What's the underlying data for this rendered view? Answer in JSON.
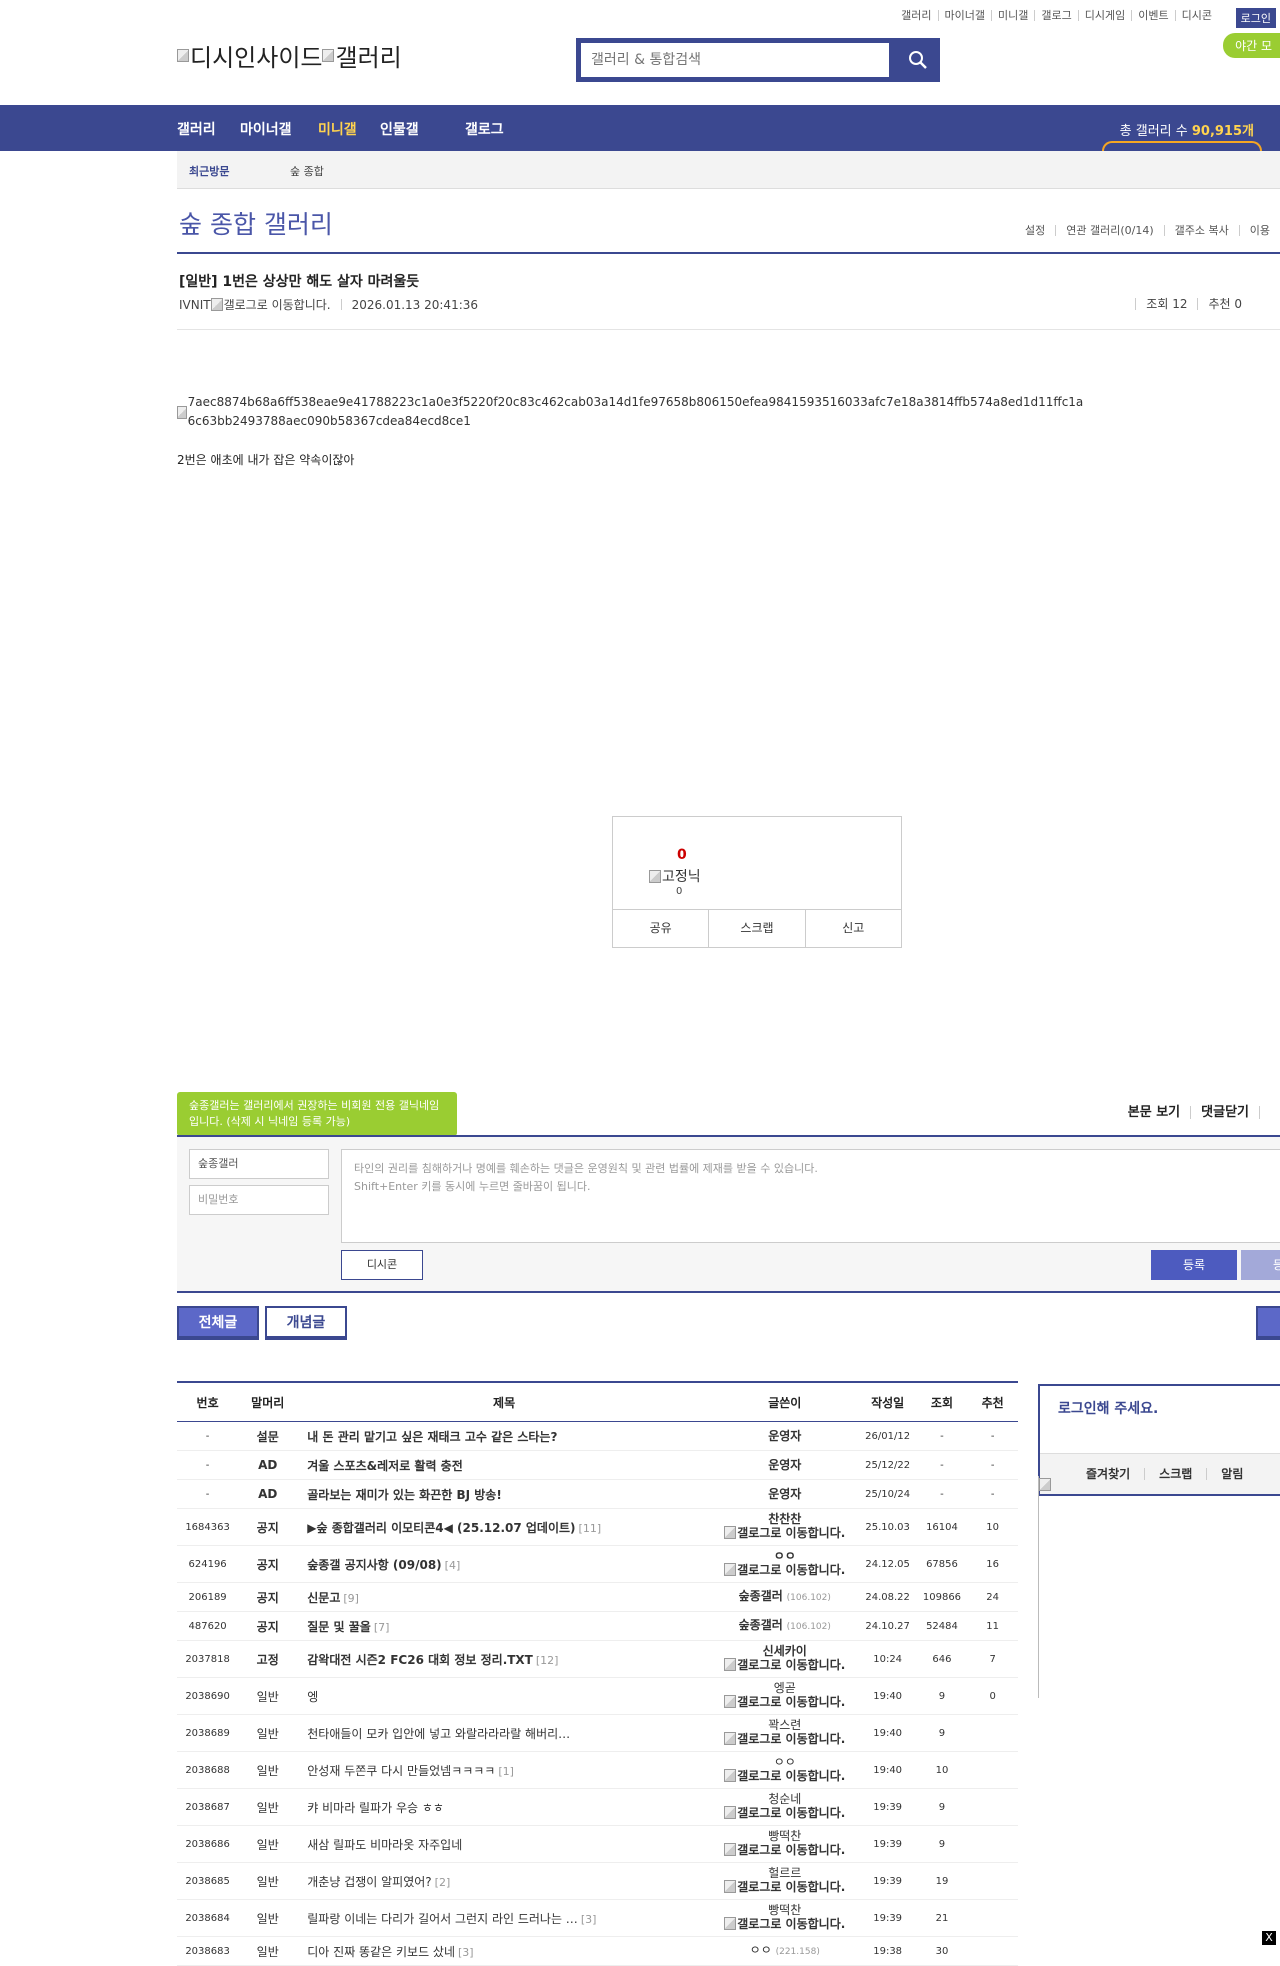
{
  "top_links": [
    "갤러리",
    "마이너갤",
    "미니갤",
    "갤로그",
    "디시게임",
    "이벤트",
    "디시콘"
  ],
  "login_label": "로그인",
  "night_mode_label": "야간 모",
  "logo_alt": "디시인사이드",
  "logo_alt2": "갤러리",
  "search_placeholder": "갤러리 & 통합검색",
  "gnb": {
    "items": [
      "갤러리",
      "마이너갤",
      "미니갤",
      "인물갤",
      "갤로그"
    ],
    "total_label": "총 갤러리 수",
    "total_value": "90,915개"
  },
  "subnav": {
    "recent_label": "최근방문",
    "recent_item": "숲 종합"
  },
  "gallery": {
    "title": "숲 종합 갤러리",
    "menu": [
      "설정",
      "연관 갤러리(0/14)",
      "갤주소 복사",
      "이용"
    ]
  },
  "post": {
    "title": "[일반] 1번은 상상만 해도 살자 마려울듯",
    "author": "IVNIT",
    "gallog_alt": "갤로그로 이동합니다.",
    "datetime": "2026.01.13 20:41:36",
    "views": "조회 12",
    "recommends": "추천 0",
    "image_alt": "7aec8874b68a6ff538eae9e41788223c1a0e3f5220f20c83c462cab03a14d1fe97658b806150efea9841593516033afc7e18a3814ffb574a8ed1d11ffc1a6c63bb2493788aec090b58367cdea84ecd8ce1",
    "body_text": "2번은 애초에 내가 잡은 약속이잖아"
  },
  "recommend_box": {
    "count": "0",
    "nick_alt": "고정닉",
    "fixed_count": "0",
    "buttons": [
      "공유",
      "스크랩",
      "신고"
    ]
  },
  "comment": {
    "tip": "숲종갤러는 갤러리에서 권장하는 비회원 전용 갤닉네임입니다. (삭제 시 닉네임 등록 가능)",
    "view_body": "본문 보기",
    "close_comments": "댓글닫기",
    "nickname_value": "숲종갤러",
    "password_placeholder": "비밀번호",
    "textarea_line1": "타인의 권리를 침해하거나 명예를 훼손하는 댓글은 운영원칙 및 관련 법률에 제재를 받을 수 있습니다.",
    "textarea_line2": "Shift+Enter 키를 동시에 누르면 줄바꿈이 됩니다.",
    "dccon_label": "디시콘",
    "submit_label": "등록",
    "submit2_label": "등록"
  },
  "tabs": {
    "all": "전체글",
    "concept": "개념글"
  },
  "list": {
    "headers": [
      "번호",
      "말머리",
      "제목",
      "글쓴이",
      "작성일",
      "조회",
      "추천"
    ],
    "rows": [
      {
        "num": "-",
        "head": "설문",
        "subject": "내 돈 관리 맡기고 싶은 재태크 고수 같은 스타는?",
        "reply": "",
        "writer": "운영자",
        "ip": "",
        "gallog": "",
        "date": "26/01/12",
        "views": "-",
        "rec": "-",
        "bold": true
      },
      {
        "num": "-",
        "head": "AD",
        "subject": "겨울 스포츠&레저로 활력 충전",
        "reply": "",
        "writer": "운영자",
        "ip": "",
        "gallog": "",
        "date": "25/12/22",
        "views": "-",
        "rec": "-",
        "bold": true
      },
      {
        "num": "-",
        "head": "AD",
        "subject": "골라보는 재미가 있는 화끈한 BJ 방송!",
        "reply": "",
        "writer": "운영자",
        "ip": "",
        "gallog": "",
        "date": "25/10/24",
        "views": "-",
        "rec": "-",
        "bold": true
      },
      {
        "num": "1684363",
        "head": "공지",
        "subject": "▶숲 종합갤러리 이모티콘4◀ (25.12.07 업데이트)",
        "reply": "[11]",
        "writer": "찬찬찬",
        "ip": "",
        "gallog": "갤로그로 이동합니다.",
        "date": "25.10.03",
        "views": "16104",
        "rec": "10",
        "bold": true
      },
      {
        "num": "624196",
        "head": "공지",
        "subject": "숲종갤 공지사항 (09/08)",
        "reply": "[4]",
        "writer": "ㅇㅇ",
        "ip": "",
        "gallog": "갤로그로 이동합니다.",
        "date": "24.12.05",
        "views": "67856",
        "rec": "16",
        "bold": true
      },
      {
        "num": "206189",
        "head": "공지",
        "subject": "신문고",
        "reply": "[9]",
        "writer": "숲종갤러",
        "ip": "(106.102)",
        "gallog": "",
        "date": "24.08.22",
        "views": "109866",
        "rec": "24",
        "bold": true
      },
      {
        "num": "487620",
        "head": "공지",
        "subject": "질문 및 꿀올",
        "reply": "[7]",
        "writer": "숲종갤러",
        "ip": "(106.102)",
        "gallog": "",
        "date": "24.10.27",
        "views": "52484",
        "rec": "11",
        "bold": true
      },
      {
        "num": "2037818",
        "head": "고정",
        "subject": "감왁대전 시즌2 FC26 대회 정보 정리.TXT",
        "reply": "[12]",
        "writer": "신세카이",
        "ip": "",
        "gallog": "갤로그로 이동합니다.",
        "date": "10:24",
        "views": "646",
        "rec": "7",
        "bold": true
      },
      {
        "num": "2038690",
        "head": "일반",
        "subject": "엥",
        "reply": "",
        "writer": "엥곧",
        "ip": "",
        "gallog": "갤로그로 이동합니다.",
        "date": "19:40",
        "views": "9",
        "rec": "0",
        "bold": false
      },
      {
        "num": "2038689",
        "head": "일반",
        "subject": "천타애들이 모카 입안에 넣고 와랄라라라랄 해버리…",
        "reply": "",
        "writer": "꽉스련",
        "ip": "",
        "gallog": "갤로그로 이동합니다.",
        "date": "19:40",
        "views": "9",
        "rec": "",
        "bold": false
      },
      {
        "num": "2038688",
        "head": "일반",
        "subject": "안성재 두쫀쿠 다시 만들었넴ㅋㅋㅋㅋ",
        "reply": "[1]",
        "writer": "ㅇㅇ",
        "ip": "",
        "gallog": "갤로그로 이동합니다.",
        "date": "19:40",
        "views": "10",
        "rec": "",
        "bold": false
      },
      {
        "num": "2038687",
        "head": "일반",
        "subject": "캬 비마라 릴파가 우승 ㅎㅎ",
        "reply": "",
        "writer": "청순네",
        "ip": "",
        "gallog": "갤로그로 이동합니다.",
        "date": "19:39",
        "views": "9",
        "rec": "",
        "bold": false
      },
      {
        "num": "2038686",
        "head": "일반",
        "subject": "새삼 릴파도 비마라옷 자주입네",
        "reply": "",
        "writer": "빵떡찬",
        "ip": "",
        "gallog": "갤로그로 이동합니다.",
        "date": "19:39",
        "views": "9",
        "rec": "",
        "bold": false
      },
      {
        "num": "2038685",
        "head": "일반",
        "subject": "개춘냥 겁쟁이 알피였어?",
        "reply": "[2]",
        "writer": "헐르르",
        "ip": "",
        "gallog": "갤로그로 이동합니다.",
        "date": "19:39",
        "views": "19",
        "rec": "",
        "bold": false
      },
      {
        "num": "2038684",
        "head": "일반",
        "subject": "릴파랑 이네는 다리가 길어서 그런지 라인 드러나는 …",
        "reply": "[3]",
        "writer": "빵떡찬",
        "ip": "",
        "gallog": "갤로그로 이동합니다.",
        "date": "19:39",
        "views": "21",
        "rec": "",
        "bold": false
      },
      {
        "num": "2038683",
        "head": "일반",
        "subject": "디아 진짜 똥같은 키보드 샀네",
        "reply": "[3]",
        "writer": "ㅇㅇ",
        "ip": "(221.158)",
        "gallog": "",
        "date": "19:38",
        "views": "30",
        "rec": "",
        "bold": false
      }
    ]
  },
  "login_box": {
    "title": "로그인해 주세요.",
    "links": [
      "즐겨찾기",
      "스크랩",
      "알림"
    ]
  },
  "close_label": "X",
  "colors": {
    "primary": "#3b4890",
    "accent_yellow": "#ffd34f",
    "tip_green": "#9acd32",
    "title_blue": "#4a56a8"
  }
}
